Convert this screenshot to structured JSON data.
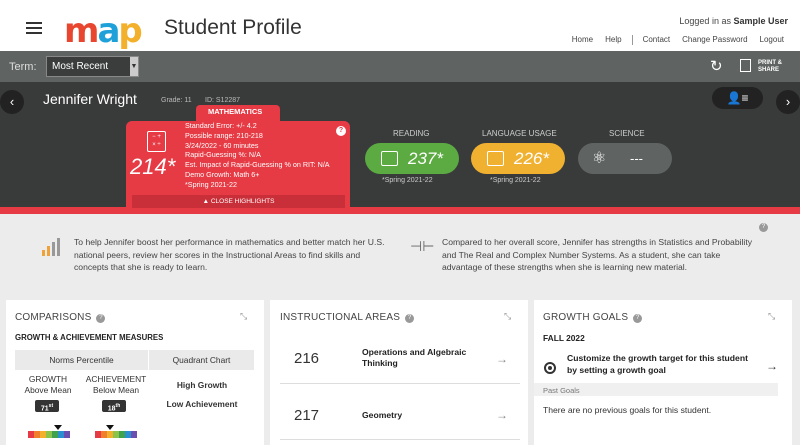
{
  "header": {
    "app_title": "Student Profile",
    "logo_text": [
      "m",
      "a",
      "p"
    ],
    "login_prefix": "Logged in as",
    "user_name": "Sample User",
    "links": [
      "Home",
      "Help",
      "Contact",
      "Change Password",
      "Logout"
    ]
  },
  "termbar": {
    "label": "Term:",
    "selected": "Most Recent",
    "print_label_line1": "PRINT &",
    "print_label_line2": "SHARE"
  },
  "student": {
    "name": "Jennifer Wright",
    "grade": "Grade: 11",
    "id": "ID: S12287"
  },
  "math": {
    "subject": "MATHEMATICS",
    "score": "214*",
    "details": [
      "Standard Error: +/- 4.2",
      "Possible range: 210-218",
      "3/24/2022 - 60 minutes",
      "Rapid-Guessing %: N/A",
      "Est. Impact of Rapid-Guessing % on RIT: N/A",
      "Demo Growth: Math 6+",
      "*Spring 2021-22"
    ],
    "close_label": "▲ CLOSE HIGHLIGHTS"
  },
  "subjects": [
    {
      "label": "READING",
      "score": "237*",
      "date": "*Spring 2021-22",
      "color": "#5cab42"
    },
    {
      "label": "LANGUAGE USAGE",
      "score": "226*",
      "date": "*Spring 2021-22",
      "color": "#f0b030"
    },
    {
      "label": "SCIENCE",
      "score": "---",
      "date": "",
      "color": "#5f6462"
    }
  ],
  "highlights": {
    "left": "To help Jennifer boost her performance in mathematics and better match her U.S. national peers, review her scores in the Instructional Areas to find skills and concepts that she is ready to learn.",
    "right": "Compared to her overall score, Jennifer has strengths in Statistics and Probability and The Real and Complex Number Systems. As a student, she can take advantage of these strengths when she is learning new material."
  },
  "comparisons": {
    "title": "COMPARISONS",
    "subtitle": "GROWTH & ACHIEVEMENT MEASURES",
    "tab_norms": "Norms Percentile",
    "tab_quadrant": "Quadrant Chart",
    "growth_label": "GROWTH",
    "growth_desc": "Above Mean",
    "growth_pct": "71",
    "growth_sup": "st",
    "achievement_label": "ACHIEVEMENT",
    "achievement_desc": "Below Mean",
    "achievement_pct": "18",
    "achievement_sup": "th",
    "quadrant_1": "High Growth",
    "quadrant_2": "Low Achievement",
    "scale_colors": [
      "#e63a44",
      "#f07e2a",
      "#f3b02c",
      "#8cc34a",
      "#3fa34d",
      "#2a8fd0",
      "#6a4fb0"
    ]
  },
  "instructional": {
    "title": "INSTRUCTIONAL AREAS",
    "rows": [
      {
        "score": "216",
        "name": "Operations and Algebraic Thinking"
      },
      {
        "score": "217",
        "name": "Geometry"
      }
    ]
  },
  "growth_goals": {
    "title": "GROWTH GOALS",
    "term": "FALL 2022",
    "customize": "Customize the growth target for this student by setting a growth goal",
    "past_label": "Past Goals",
    "none_text": "There are no previous goals for this student."
  }
}
